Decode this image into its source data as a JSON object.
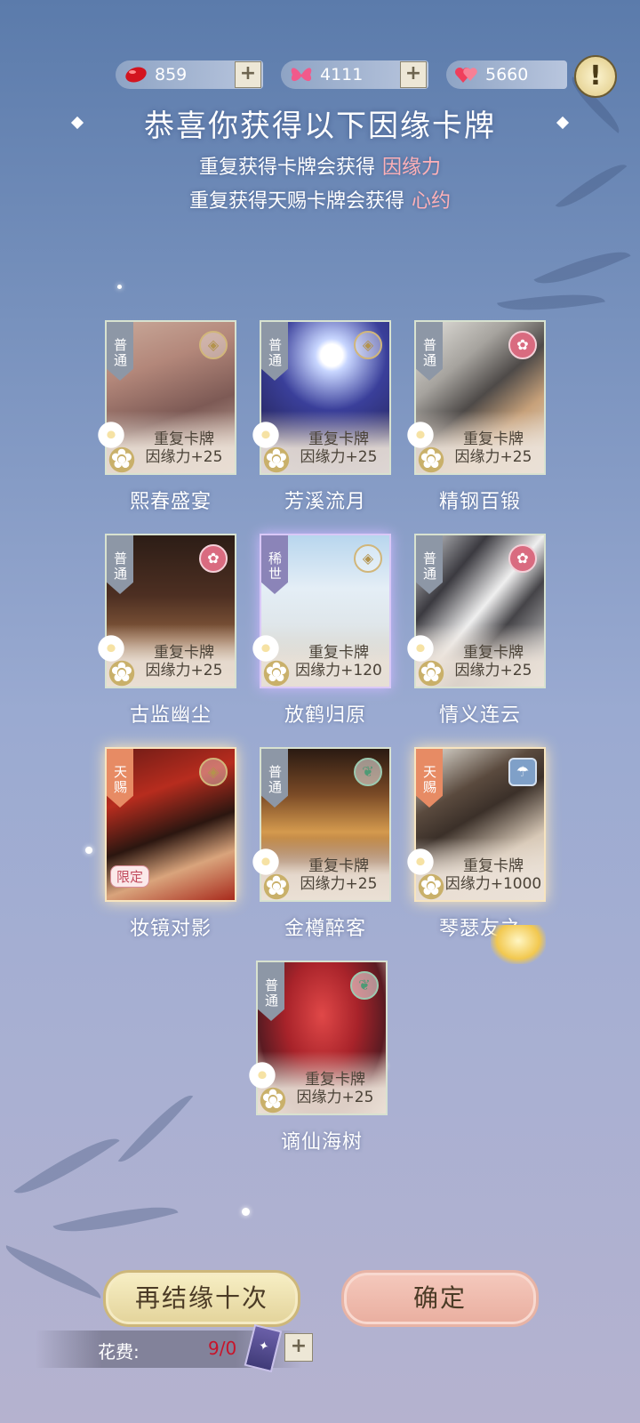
{
  "resources": [
    {
      "icon": "red-bean-icon",
      "value": "859"
    },
    {
      "icon": "butterfly-icon",
      "value": "4111"
    },
    {
      "icon": "hearts-icon",
      "value": "5660"
    }
  ],
  "alert_label": "!",
  "title": "恭喜你获得以下因缘卡牌",
  "subtitle1": {
    "text": "重复获得卡牌会获得",
    "highlight": "因缘力"
  },
  "subtitle2": {
    "text": "重复获得天赐卡牌会获得",
    "highlight": "心约"
  },
  "cards": [
    {
      "name": "熙春盛宴",
      "rarity": "普通",
      "emblem": "coin-icon",
      "dup_line1": "重复卡牌",
      "dup_line2": "因缘力+25",
      "limited": ""
    },
    {
      "name": "芳溪流月",
      "rarity": "普通",
      "emblem": "coin-icon",
      "dup_line1": "重复卡牌",
      "dup_line2": "因缘力+25",
      "limited": ""
    },
    {
      "name": "精钢百锻",
      "rarity": "普通",
      "emblem": "plum-blossom-icon",
      "dup_line1": "重复卡牌",
      "dup_line2": "因缘力+25",
      "limited": ""
    },
    {
      "name": "古监幽尘",
      "rarity": "普通",
      "emblem": "plum-blossom-icon",
      "dup_line1": "重复卡牌",
      "dup_line2": "因缘力+25",
      "limited": ""
    },
    {
      "name": "放鹤归原",
      "rarity": "稀世",
      "emblem": "coin-icon",
      "dup_line1": "重复卡牌",
      "dup_line2": "因缘力+120",
      "limited": ""
    },
    {
      "name": "情义连云",
      "rarity": "普通",
      "emblem": "plum-blossom-icon",
      "dup_line1": "重复卡牌",
      "dup_line2": "因缘力+25",
      "limited": ""
    },
    {
      "name": "妆镜对影",
      "rarity": "天赐",
      "emblem": "coin-icon",
      "dup_line1": "",
      "dup_line2": "",
      "limited": "限定"
    },
    {
      "name": "金樽醉客",
      "rarity": "普通",
      "emblem": "leaf-icon",
      "dup_line1": "重复卡牌",
      "dup_line2": "因缘力+25",
      "limited": ""
    },
    {
      "name": "琴瑟友之",
      "rarity": "天赐",
      "emblem": "umbrella-icon",
      "dup_line1": "重复卡牌",
      "dup_line2": "因缘力+1000",
      "limited": ""
    },
    {
      "name": "谪仙海树",
      "rarity": "普通",
      "emblem": "leaf-icon",
      "dup_line1": "重复卡牌",
      "dup_line2": "因缘力+25",
      "limited": ""
    }
  ],
  "buttons": {
    "again": "再结缘十次",
    "confirm": "确定"
  },
  "cost": {
    "label": "花费:",
    "value": "9/0",
    "plus": "+"
  },
  "colors": {
    "normal_badge": "#8d97a6",
    "rare_badge": "#8b84b8",
    "gift_badge": "#e78b64",
    "highlight": "#ffb1b7",
    "cost_value": "#c8142a"
  }
}
